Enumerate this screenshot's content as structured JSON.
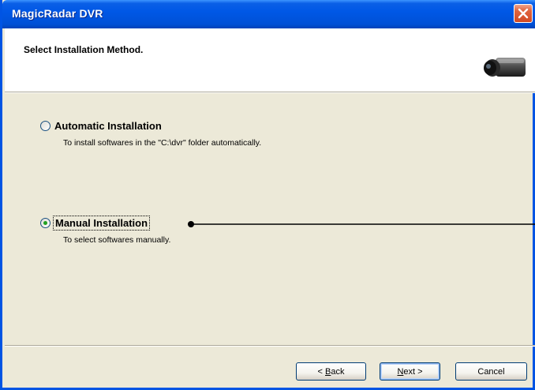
{
  "window": {
    "title": "MagicRadar DVR"
  },
  "header": {
    "title": "Select Installation Method.",
    "icon": "camera-icon"
  },
  "options": [
    {
      "label": "Automatic Installation",
      "description": "To install softwares in the \"C:\\dvr\" folder automatically.",
      "selected": false
    },
    {
      "label": "Manual Installation",
      "description": "To select softwares manually.",
      "selected": true
    }
  ],
  "buttons": {
    "back_prefix": "< ",
    "back_hotkey": "B",
    "back_rest": "ack",
    "next_hotkey": "N",
    "next_rest": "ext >",
    "cancel": "Cancel"
  },
  "colors": {
    "titlebar": "#0058e6",
    "dialog_bg": "#ece9d8",
    "radio_dot": "#21a121",
    "close_button": "#d24a24"
  }
}
